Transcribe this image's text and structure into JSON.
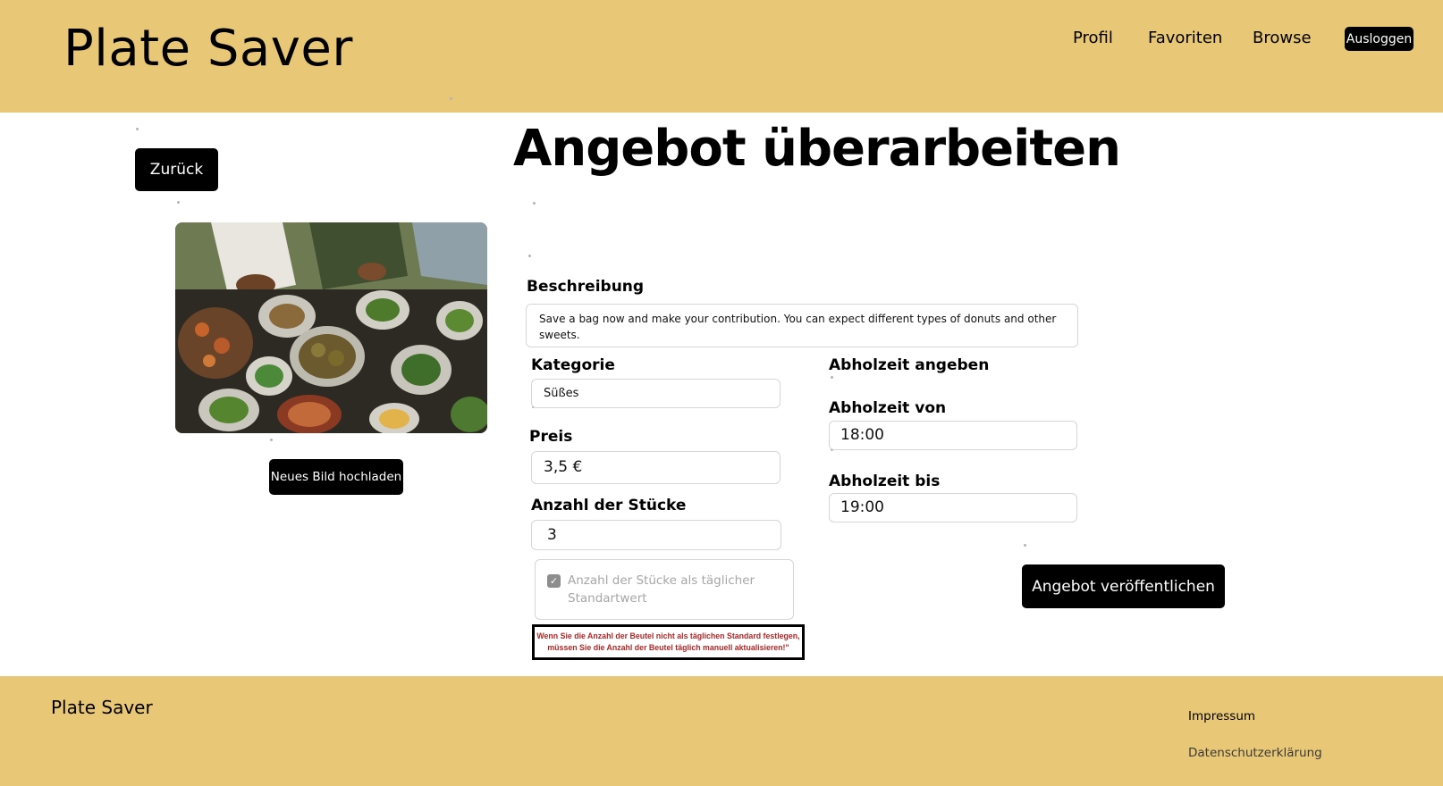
{
  "header": {
    "brand": "Plate Saver",
    "nav": [
      "Profil",
      "Favoriten",
      "Browse"
    ],
    "logout_label": "Ausloggen"
  },
  "page": {
    "back_label": "Zurück",
    "title": "Angebot überarbeiten",
    "upload_label": "Neues Bild hochladen"
  },
  "form": {
    "description_label": "Beschreibung",
    "description_value": "Save a bag now and make your contribution. You can expect different types of donuts and other sweets.",
    "category_label": "Kategorie",
    "category_value": "Süßes",
    "price_label": "Preis",
    "price_value": "3,5 €",
    "quantity_label": "Anzahl der Stücke",
    "quantity_value": "3",
    "default_checkbox_label": "Anzahl der Stücke als täglicher Standartwert",
    "default_checkbox_checked": true,
    "warning_text": "Wenn Sie die Anzahl der Beutel nicht als täglichen Standard festlegen, müssen Sie die Anzahl der Beutel täglich manuell aktualisieren!\"",
    "pickup_heading": "Abholzeit angeben",
    "pickup_from_label": "Abholzeit von",
    "pickup_from_value": "18:00",
    "pickup_to_label": "Abholzeit bis",
    "pickup_to_value": "19:00",
    "publish_label": "Angebot veröffentlichen"
  },
  "footer": {
    "brand": "Plate Saver",
    "links": [
      "Impressum",
      "Datenschutzerklärung"
    ]
  },
  "colors": {
    "brand_yellow": "#e8c776",
    "button_black": "#000000",
    "warning_red": "#b22626"
  },
  "icons": {
    "checkbox": "check-icon"
  }
}
